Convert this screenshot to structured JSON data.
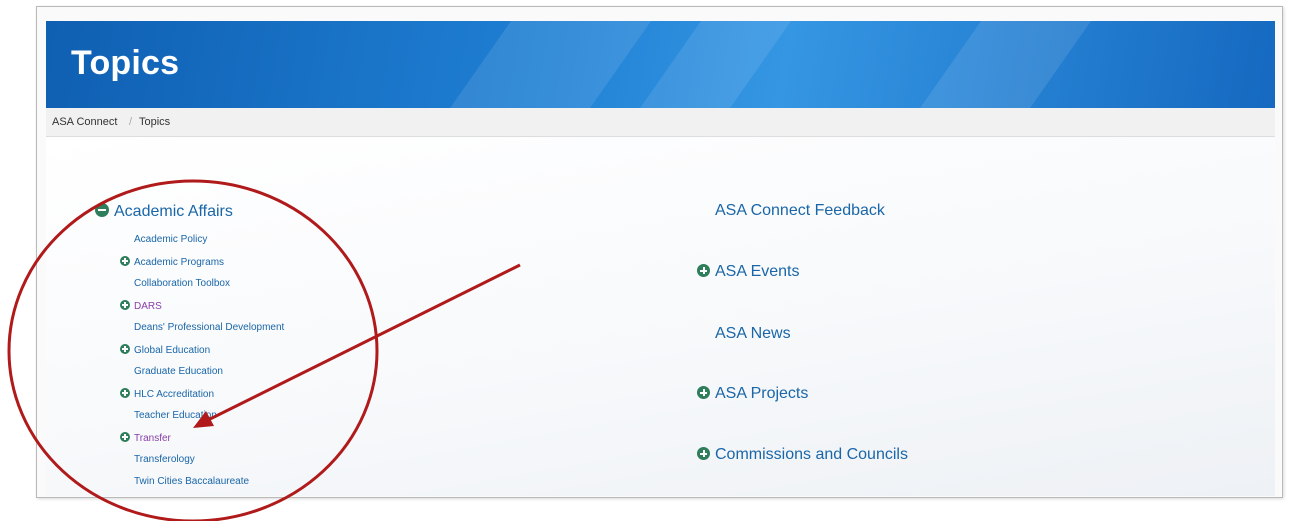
{
  "header": {
    "title": "Topics"
  },
  "breadcrumb": {
    "items": [
      "ASA Connect",
      "Topics"
    ],
    "separator": "/"
  },
  "left_group": {
    "title": "Academic Affairs",
    "expanded": true,
    "items": [
      {
        "label": "Academic Policy",
        "has_children": false,
        "visited": false
      },
      {
        "label": "Academic Programs",
        "has_children": true,
        "visited": false
      },
      {
        "label": "Collaboration Toolbox",
        "has_children": false,
        "visited": false
      },
      {
        "label": "DARS",
        "has_children": true,
        "visited": true
      },
      {
        "label": "Deans' Professional Development",
        "has_children": false,
        "visited": false
      },
      {
        "label": "Global Education",
        "has_children": true,
        "visited": false
      },
      {
        "label": "Graduate Education",
        "has_children": false,
        "visited": false
      },
      {
        "label": "HLC Accreditation",
        "has_children": true,
        "visited": false
      },
      {
        "label": "Teacher Education",
        "has_children": false,
        "visited": false
      },
      {
        "label": "Transfer",
        "has_children": true,
        "visited": true
      },
      {
        "label": "Transferology",
        "has_children": false,
        "visited": false
      },
      {
        "label": "Twin Cities Baccalaureate",
        "has_children": false,
        "visited": false
      }
    ]
  },
  "right_topics": [
    {
      "label": "ASA Connect Feedback",
      "has_children": false
    },
    {
      "label": "ASA Events",
      "has_children": true
    },
    {
      "label": "ASA News",
      "has_children": false
    },
    {
      "label": "ASA Projects",
      "has_children": true
    },
    {
      "label": "Commissions and Councils",
      "has_children": true
    }
  ],
  "colors": {
    "link": "#1a66a8",
    "visited": "#8a3ea8",
    "expand_icon": "#2e7d5b",
    "banner": "#1f7fd3",
    "annotation": "#b01a1a"
  }
}
